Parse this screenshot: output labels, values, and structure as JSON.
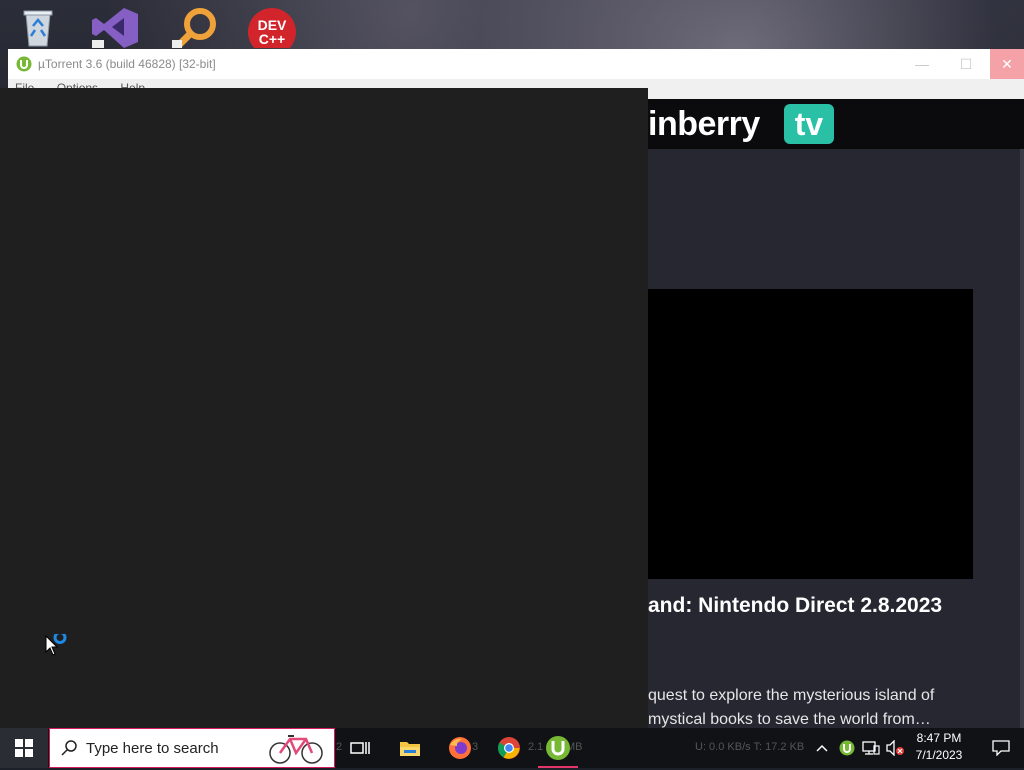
{
  "desktop": {
    "icons": [
      "recycle-bin",
      "visual-studio",
      "search-app",
      "dev-cpp"
    ],
    "devcpp_label": "DEV\nC++"
  },
  "window": {
    "title": "µTorrent 3.6  (build 46828) [32-bit]",
    "menu": [
      "File",
      "Options",
      "Help"
    ],
    "minimize": "—",
    "maximize": "☐",
    "close": "✕"
  },
  "ad": {
    "logo_text": "inberry",
    "logo_tv": "tv",
    "headline": "and: Nintendo Direct 2.8.2023",
    "description_line1": "quest to explore the mysterious island of",
    "description_line2": "mystical books to save the world from…"
  },
  "taskbar": {
    "search_placeholder": "Type here to search",
    "ghost_text_1": "2",
    "ghost_text_2": "3",
    "ghost_text_3": "2.1",
    "ghost_text_4": "MB",
    "status_text": "U: 0.0 KB/s T: 17.2 KB",
    "clock_time": "8:47 PM",
    "clock_date": "7/1/2023"
  },
  "colors": {
    "accent": "#e3356b",
    "rainberry_teal": "#2ac0a6",
    "utorrent_green": "#77b834"
  }
}
